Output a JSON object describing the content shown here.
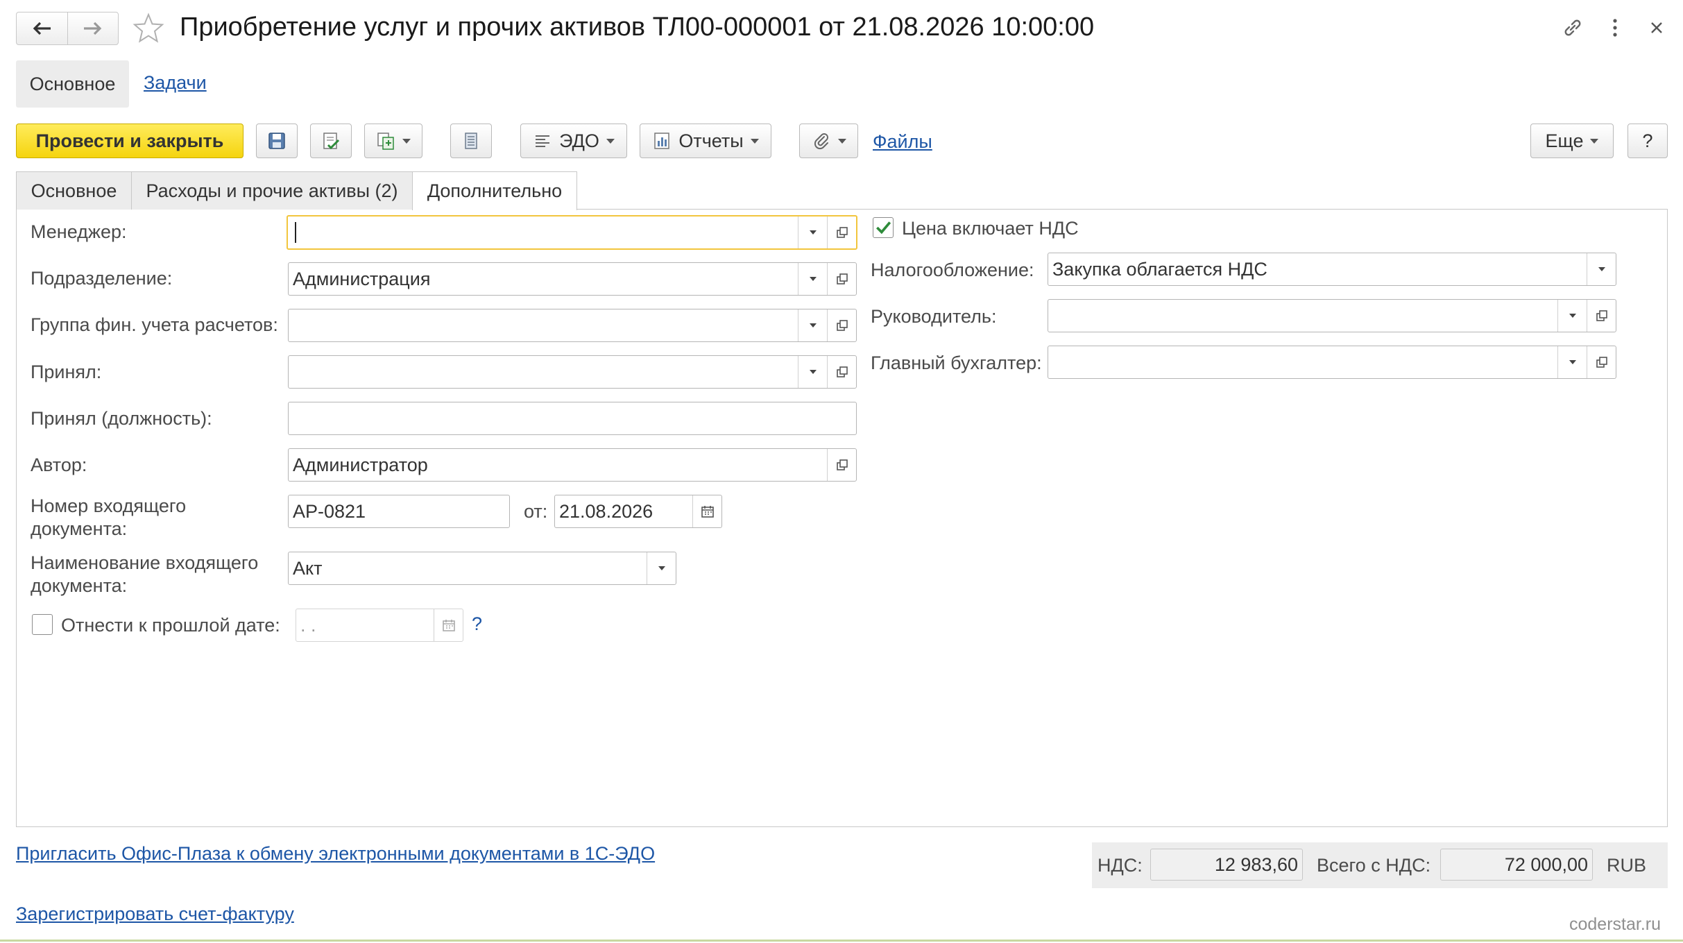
{
  "window": {
    "title": "Приобретение услуг и прочих активов ТЛ00-000001 от 21.08.2026 10:00:00"
  },
  "sections": {
    "main_label": "Основное",
    "tasks_label": "Задачи"
  },
  "toolbar": {
    "post_close_label": "Провести и закрыть",
    "edo_label": "ЭДО",
    "reports_label": "Отчеты",
    "files_label": "Файлы",
    "more_label": "Еще",
    "help_label": "?"
  },
  "tabs": [
    {
      "label": "Основное"
    },
    {
      "label": "Расходы и прочие активы (2)"
    },
    {
      "label": "Дополнительно"
    }
  ],
  "form": {
    "manager": {
      "label": "Менеджер:",
      "value": ""
    },
    "department": {
      "label": "Подразделение:",
      "value": "Администрация"
    },
    "fin_group": {
      "label": "Группа фин. учета расчетов:",
      "value": ""
    },
    "accepted": {
      "label": "Принял:",
      "value": ""
    },
    "accepted_position": {
      "label": "Принял (должность):",
      "value": ""
    },
    "author": {
      "label": "Автор:",
      "value": "Администратор"
    },
    "incoming_number": {
      "label": "Номер входящего документа:",
      "value": "АР-0821"
    },
    "from_label": "от:",
    "incoming_date": "21.08.2026",
    "incoming_name": {
      "label": "Наименование входящего документа:",
      "value": "Акт"
    },
    "past_date": {
      "label": "Отнести к прошлой дате:",
      "checked": false,
      "value": " .  .",
      "help": "?"
    },
    "price_includes_vat": {
      "label": "Цена включает НДС",
      "checked": true
    },
    "taxation": {
      "label": "Налогообложение:",
      "value": "Закупка облагается НДС"
    },
    "head": {
      "label": "Руководитель:",
      "value": ""
    },
    "chief_accountant": {
      "label": "Главный бухгалтер:",
      "value": ""
    }
  },
  "footer": {
    "invite_link": "Пригласить Офис-Плаза к обмену электронными документами в 1С-ЭДО",
    "register_link": "Зарегистрировать счет-фактуру",
    "vat_label": "НДС:",
    "vat_value": "12 983,60",
    "total_label": "Всего с НДС:",
    "total_value": "72 000,00",
    "currency": "RUB"
  },
  "watermark": "coderstar.ru",
  "colors": {
    "primary_button": "#f5d40f",
    "link": "#1d56a6",
    "focus_border": "#f2c53d",
    "checkbox_check": "#2e8b3a"
  },
  "icons": {
    "back": "arrow-left-icon",
    "forward": "arrow-right-icon",
    "favorite": "star-icon",
    "link": "link-icon",
    "menu": "kebab-menu-icon",
    "close": "close-icon",
    "save": "save-icon",
    "post": "post-document-icon",
    "create_based": "create-based-icon",
    "print": "print-icon",
    "attach": "paperclip-icon",
    "open": "open-icon",
    "calendar": "calendar-icon"
  }
}
